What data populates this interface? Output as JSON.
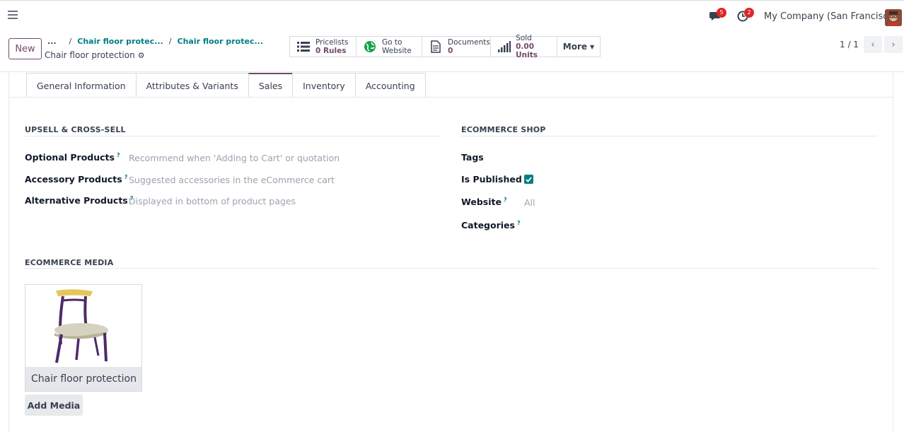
{
  "topbar": {
    "messages_badge": "5",
    "activities_badge": "2",
    "company": "My Company (San Francisco)"
  },
  "control": {
    "new_label": "New",
    "breadcrumb_dots": "...",
    "breadcrumbs": [
      "Chair floor protec...",
      "Chair floor protec..."
    ],
    "record_title": "Chair floor protection",
    "smart_buttons": [
      {
        "line1": "Pricelists",
        "line2": "0 Rules",
        "icon": "list-icon"
      },
      {
        "line1": "Go to",
        "line2": "Website",
        "icon": "globe-icon"
      },
      {
        "line1": "Documents",
        "line2": "0",
        "icon": "document-icon"
      },
      {
        "line1": "Sold",
        "line2": "0.00 Units",
        "icon": "signal-icon"
      }
    ],
    "more_label": "More",
    "pager": "1 / 1"
  },
  "tabs": [
    "General Information",
    "Attributes & Variants",
    "Sales",
    "Inventory",
    "Accounting"
  ],
  "active_tab": "Sales",
  "upsell": {
    "title": "UPSELL & CROSS-SELL",
    "fields": [
      {
        "label": "Optional Products",
        "help": "?",
        "placeholder": "Recommend when 'Adding to Cart' or quotation"
      },
      {
        "label": "Accessory Products",
        "help": "?",
        "placeholder": "Suggested accessories in the eCommerce cart"
      },
      {
        "label": "Alternative Products",
        "help": "?",
        "placeholder": "Displayed in bottom of product pages"
      }
    ]
  },
  "ecommerce_shop": {
    "title": "ECOMMERCE SHOP",
    "tags_label": "Tags",
    "published_label": "Is Published",
    "is_published": true,
    "website_label": "Website",
    "website_help": "?",
    "website_value": "All",
    "categories_label": "Categories",
    "categories_help": "?"
  },
  "ecommerce_media": {
    "title": "ECOMMERCE MEDIA",
    "media_caption": "Chair floor protection",
    "add_media_label": "Add Media"
  },
  "colors": {
    "brand": "#714b67",
    "accent": "#017e84",
    "badge": "#dc2626"
  }
}
